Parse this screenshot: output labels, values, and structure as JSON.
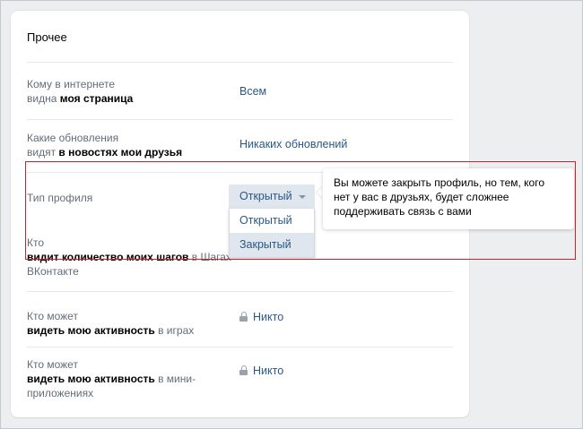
{
  "section": {
    "title": "Прочее"
  },
  "rows": {
    "page_visibility": {
      "label_normal": "Кому в интернете",
      "label_prefix": "видна ",
      "label_bold": "моя страница",
      "value": "Всем"
    },
    "updates": {
      "label_normal": "Какие обновления",
      "label_prefix": "видят ",
      "label_bold": "в новостях мои друзья",
      "value": "Никаких обновлений"
    },
    "profile_type": {
      "label": "Тип профиля",
      "selected": "Открытый",
      "options": [
        "Открытый",
        "Закрытый"
      ],
      "highlighted_option": "Закрытый"
    },
    "steps": {
      "label_normal": "Кто",
      "label_bold": "видит количество моих шагов",
      "label_suffix": " в Шагах",
      "label_line3": "ВКонтакте"
    },
    "games": {
      "label_normal": "Кто может",
      "label_bold": "видеть мою активность",
      "label_suffix": " в играх",
      "value": "Никто",
      "icon": "lock-icon"
    },
    "mini_apps": {
      "label_normal": "Кто может",
      "label_bold": "видеть мою активность",
      "label_suffix": " в мини-",
      "label_line3": "приложениях",
      "value": "Никто",
      "icon": "lock-icon"
    }
  },
  "tooltip": {
    "text": "Вы можете закрыть профиль, но тем, кого нет у вас в друзьях, будет сложнее поддерживать связь с вами"
  },
  "colors": {
    "link": "#2a5885",
    "muted": "#626d7a",
    "highlight": "#d81f26",
    "background": "#edeef0"
  }
}
